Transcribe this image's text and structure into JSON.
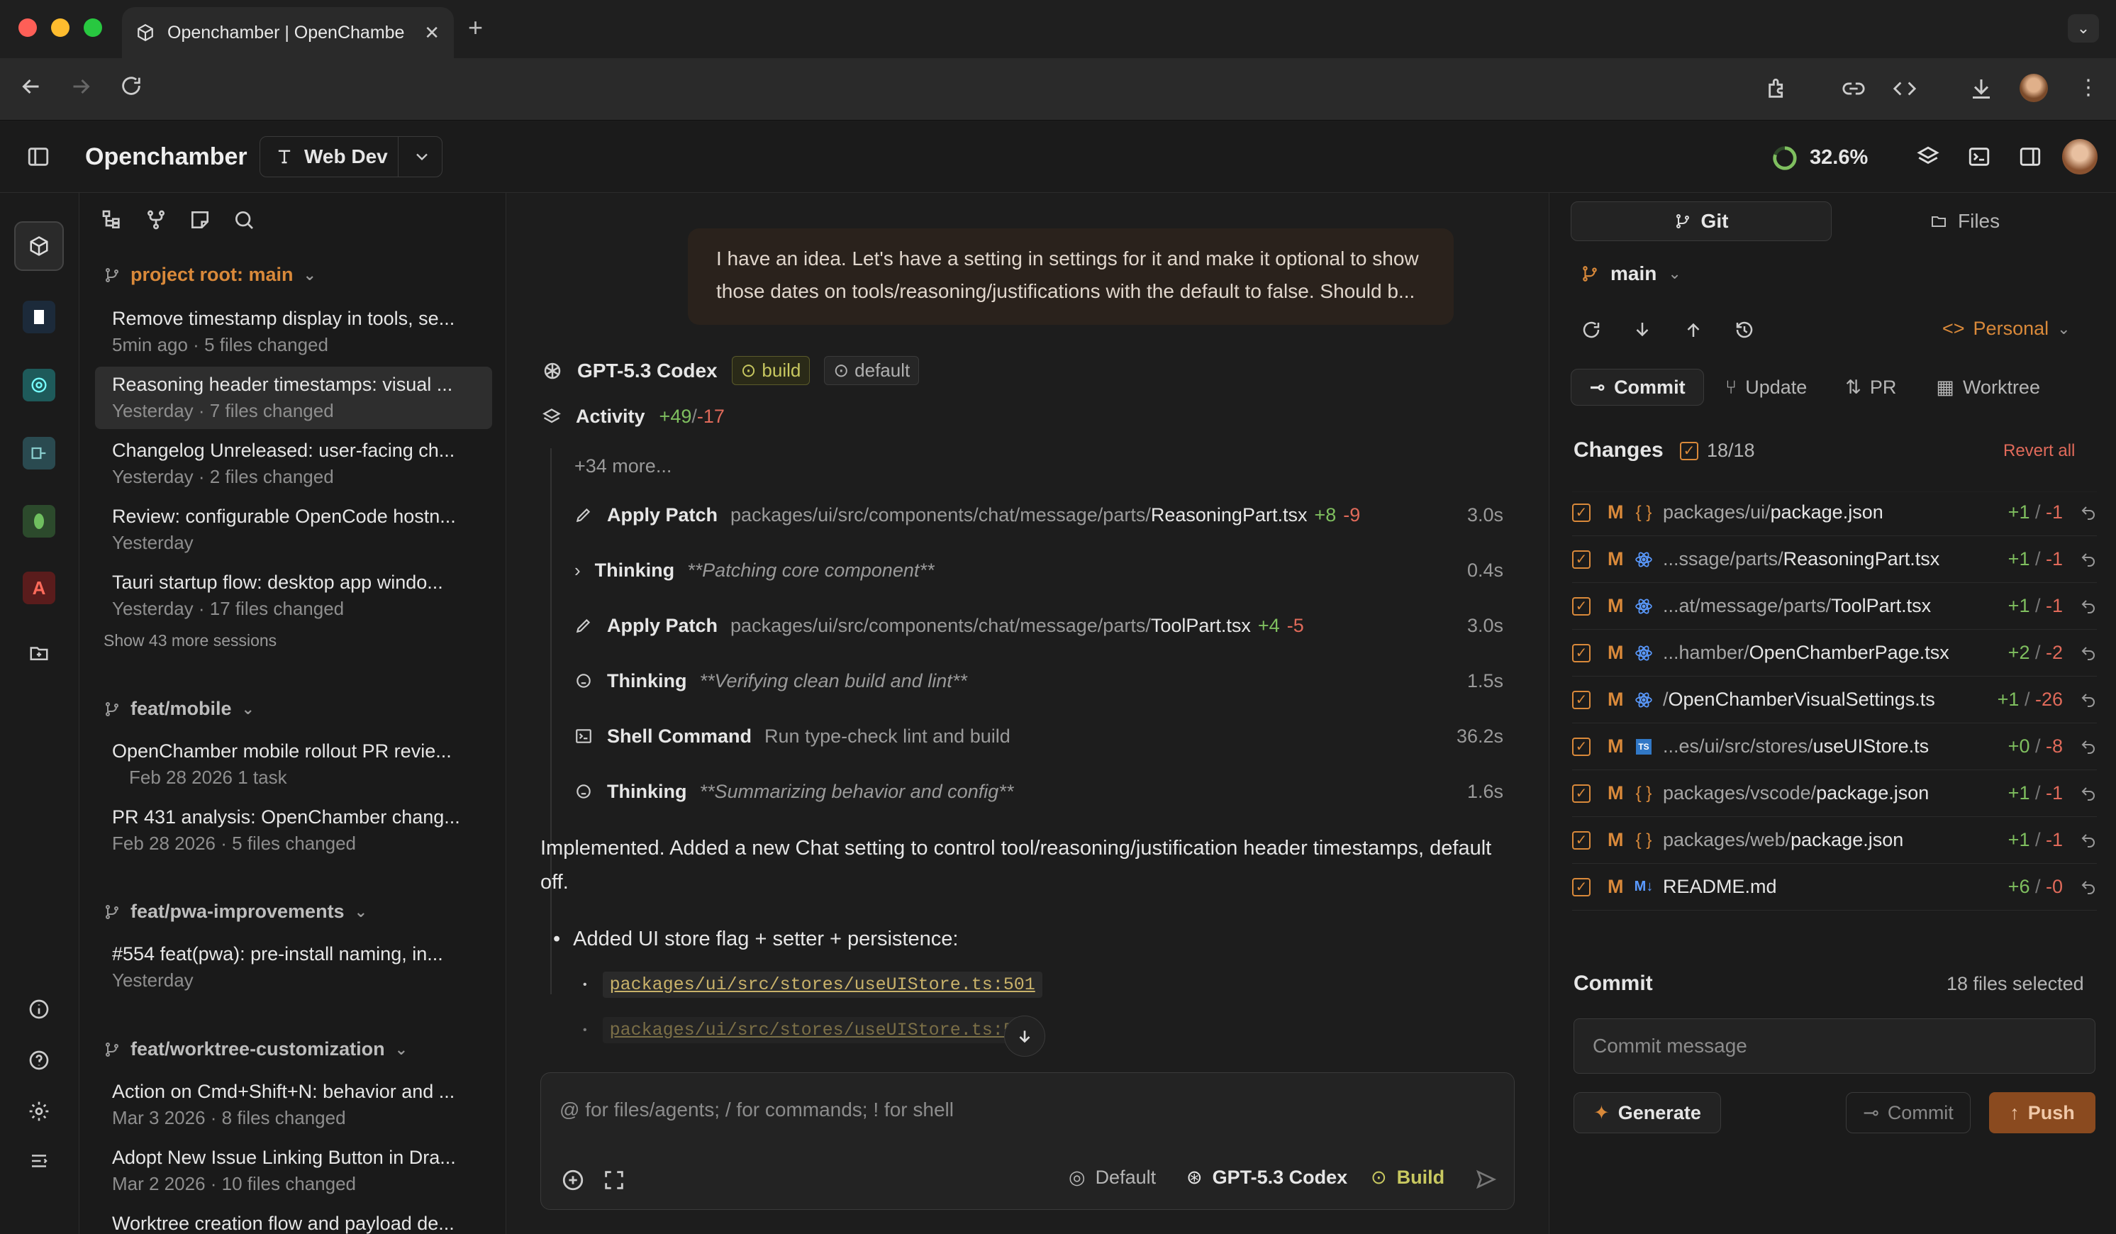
{
  "browser": {
    "tab_title": "Openchamber | OpenChambe",
    "new_tab": "+"
  },
  "header": {
    "app_name": "Openchamber",
    "workspace": "Web Dev",
    "usage": "32.6%"
  },
  "sidebar": {
    "groups": [
      {
        "label": "project root: main"
      },
      {
        "label": "feat/mobile"
      },
      {
        "label": "feat/pwa-improvements"
      },
      {
        "label": "feat/worktree-customization"
      }
    ],
    "sessions": [
      {
        "title": "Remove timestamp display in tools, se...",
        "meta": "5min ago  · 5 files changed"
      },
      {
        "title": "Reasoning header timestamps: visual ...",
        "meta": "Yesterday  · 7 files changed"
      },
      {
        "title": "Changelog Unreleased: user-facing ch...",
        "meta": "Yesterday  · 2 files changed"
      },
      {
        "title": "Review: configurable OpenCode hostn...",
        "meta": "Yesterday"
      },
      {
        "title": "Tauri startup flow: desktop app windo...",
        "meta": "Yesterday  · 17 files changed"
      },
      {
        "title": "OpenChamber mobile rollout PR revie...",
        "meta": "Feb 28 2026   1 task"
      },
      {
        "title": "PR 431 analysis: OpenChamber chang...",
        "meta": "Feb 28 2026  · 5 files changed"
      },
      {
        "title": "#554 feat(pwa): pre-install naming, in...",
        "meta": "Yesterday"
      },
      {
        "title": "Action on Cmd+Shift+N: behavior and ...",
        "meta": "Mar 3 2026  · 8 files changed"
      },
      {
        "title": "Adopt New Issue Linking Button in Dra...",
        "meta": "Mar 2 2026  · 10 files changed"
      },
      {
        "title": "Worktree creation flow and payload de...",
        "meta": ""
      }
    ],
    "show_more": "Show 43 more sessions"
  },
  "chat": {
    "user_message": "I have an idea. Let's have a setting in settings for it and make it optional to show those dates on tools/reasoning/justifications with the default to false. Should b...",
    "model": "GPT-5.3 Codex",
    "badge_build": "build",
    "badge_default": "default",
    "activity_label": "Activity",
    "activity_add": "+49",
    "activity_sep": "/",
    "activity_del": "-17",
    "more": "+34 more...",
    "steps": [
      {
        "name": "Apply Patch",
        "dir": "packages/ui/src/components/chat/message/parts/",
        "file": "ReasoningPart.tsx",
        "add": "+8",
        "del": "-9",
        "time": "3.0s"
      },
      {
        "name": "Thinking",
        "detail": "**Patching core component**",
        "time": "0.4s"
      },
      {
        "name": "Apply Patch",
        "dir": "packages/ui/src/components/chat/message/parts/",
        "file": "ToolPart.tsx",
        "add": "+4",
        "del": "-5",
        "time": "3.0s"
      },
      {
        "name": "Thinking",
        "detail": "**Verifying clean build and lint**",
        "time": "1.5s"
      },
      {
        "name": "Shell Command",
        "detail": "Run type-check lint and build",
        "time": "36.2s"
      },
      {
        "name": "Thinking",
        "detail": "**Summarizing behavior and config**",
        "time": "1.6s"
      }
    ],
    "reply": "Implemented. Added a new Chat setting to control tool/reasoning/justification header timestamps, default off.",
    "bullet": "Added UI store flag + setter + persistence:",
    "links": [
      "packages/ui/src/stores/useUIStore.ts:501",
      "packages/ui/src/stores/useUIStore.ts:5"
    ],
    "input_placeholder": "@ for files/agents; / for commands; ! for shell",
    "footer_agent": "Default",
    "footer_model": "GPT-5.3 Codex",
    "footer_mode": "Build"
  },
  "right": {
    "tab_git": "Git",
    "tab_files": "Files",
    "branch": "main",
    "identity": "Personal",
    "actions": [
      "Commit",
      "Update",
      "PR",
      "Worktree"
    ],
    "changes_label": "Changes",
    "changes_count": "18/18",
    "revert_all": "Revert all",
    "files": [
      {
        "status": "M",
        "dir": "packages/ui/",
        "name": "package.json",
        "add": "+1",
        "del": "-1",
        "icon": "json-icon"
      },
      {
        "status": "M",
        "dir": "...ssage/parts/",
        "name": "ReasoningPart.tsx",
        "add": "+1",
        "del": "-1",
        "icon": "react-icon"
      },
      {
        "status": "M",
        "dir": "...at/message/parts/",
        "name": "ToolPart.tsx",
        "add": "+1",
        "del": "-1",
        "icon": "react-icon"
      },
      {
        "status": "M",
        "dir": "...hamber/",
        "name": "OpenChamberPage.tsx",
        "add": "+2",
        "del": "-2",
        "icon": "react-icon"
      },
      {
        "status": "M",
        "dir": "/",
        "name": "OpenChamberVisualSettings.ts",
        "add": "+1",
        "del": "-26",
        "icon": "react-icon"
      },
      {
        "status": "M",
        "dir": "...es/ui/src/stores/",
        "name": "useUIStore.ts",
        "add": "+0",
        "del": "-8",
        "icon": "ts-icon"
      },
      {
        "status": "M",
        "dir": "packages/vscode/",
        "name": "package.json",
        "add": "+1",
        "del": "-1",
        "icon": "json-icon"
      },
      {
        "status": "M",
        "dir": "packages/web/",
        "name": "package.json",
        "add": "+1",
        "del": "-1",
        "icon": "json-icon"
      },
      {
        "status": "M",
        "dir": "",
        "name": "README.md",
        "add": "+6",
        "del": "-0",
        "icon": "markdown-icon"
      }
    ],
    "commit_label": "Commit",
    "selected": "18 files selected",
    "commit_placeholder": "Commit message",
    "generate": "Generate",
    "commit_btn": "Commit",
    "push": "Push"
  },
  "colors": {
    "accent": "#d9893a",
    "add": "#7fbf5f",
    "del": "#e06a5a",
    "push_bg": "#8a4a1f"
  }
}
